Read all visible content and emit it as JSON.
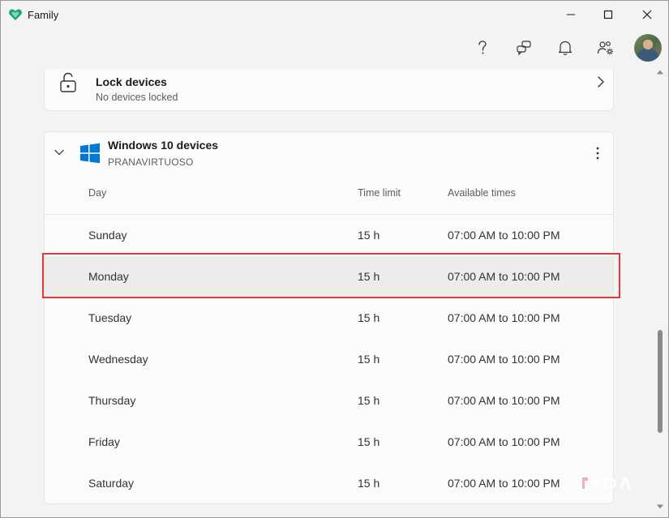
{
  "window": {
    "title": "Family"
  },
  "header": {
    "help_icon": "help-icon",
    "feedback_icon": "feedback-icon",
    "notifications_icon": "bell-icon",
    "family_settings_icon": "people-settings-icon"
  },
  "lock_devices": {
    "title": "Lock devices",
    "subtitle": "No devices locked"
  },
  "device": {
    "title": "Windows 10 devices",
    "account": "PRANAVIRTUOSO",
    "columns": [
      "Day",
      "Time limit",
      "Available times"
    ],
    "rows": [
      {
        "day": "Sunday",
        "limit": "15 h",
        "times": "07:00 AM to 10:00 PM"
      },
      {
        "day": "Monday",
        "limit": "15 h",
        "times": "07:00 AM to 10:00 PM"
      },
      {
        "day": "Tuesday",
        "limit": "15 h",
        "times": "07:00 AM to 10:00 PM"
      },
      {
        "day": "Wednesday",
        "limit": "15 h",
        "times": "07:00 AM to 10:00 PM"
      },
      {
        "day": "Thursday",
        "limit": "15 h",
        "times": "07:00 AM to 10:00 PM"
      },
      {
        "day": "Friday",
        "limit": "15 h",
        "times": "07:00 AM to 10:00 PM"
      },
      {
        "day": "Saturday",
        "limit": "15 h",
        "times": "07:00 AM to 10:00 PM"
      }
    ],
    "selected_row": "Monday"
  },
  "colors": {
    "accent": "#0078d4",
    "highlight": "#e0393e",
    "app_logo": "#1aa37a"
  },
  "watermark": {
    "text": "XDA"
  }
}
